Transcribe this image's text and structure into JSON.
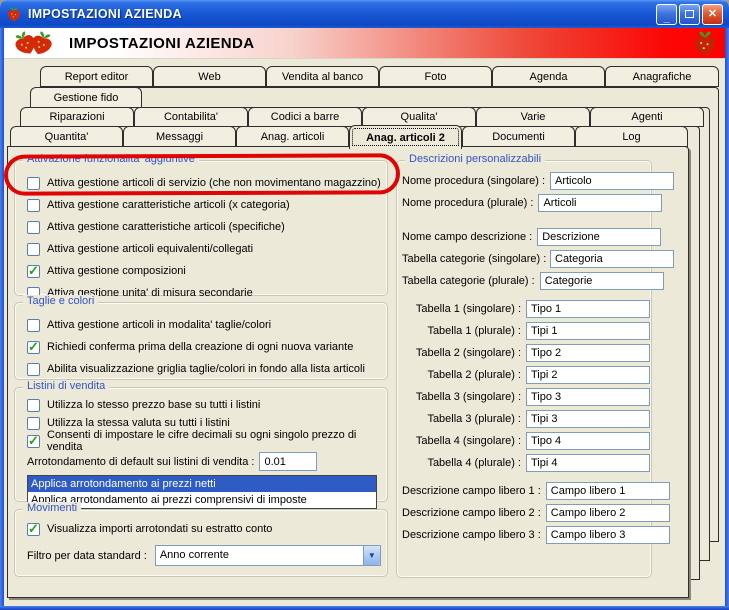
{
  "window": {
    "title": "IMPOSTAZIONI AZIENDA"
  },
  "titlebar_buttons": {
    "minimize": "_",
    "maximize": "",
    "close": "✕"
  },
  "header": {
    "title": "IMPOSTAZIONI AZIENDA"
  },
  "colors": {
    "titlebar_blue": "#1A5AD8",
    "header_red": "#FF0000",
    "group_caption_blue": "#3353C6",
    "selection_blue": "#2F5BC5",
    "check_green": "#1EA11E",
    "annotation_red": "#E00505",
    "window_border_blue": "#1C4FD0",
    "background_beige": "#ECE9D8"
  },
  "tabs": {
    "row1": [
      "Report editor",
      "Web",
      "Vendita al banco",
      "Foto",
      "Agenda",
      "Anagrafiche"
    ],
    "row2": [
      "Gestione fido"
    ],
    "row3": [
      "Riparazioni",
      "Contabilita'",
      "Codici a barre",
      "Qualita'",
      "Varie",
      "Agenti"
    ],
    "row4": [
      "Quantita'",
      "Messaggi",
      "Anag. articoli",
      "Anag. articoli 2",
      "Documenti",
      "Log"
    ],
    "active": "Anag. articoli 2"
  },
  "attivazione": {
    "title": "Attivazione funzionalita' aggiuntive",
    "items": [
      {
        "label": "Attiva gestione articoli di servizio (che non movimentano magazzino)",
        "checked": false
      },
      {
        "label": "Attiva gestione caratteristiche articoli (x categoria)",
        "checked": false
      },
      {
        "label": "Attiva gestione caratteristiche articoli (specifiche)",
        "checked": false
      },
      {
        "label": "Attiva gestione articoli equivalenti/collegati",
        "checked": false
      },
      {
        "label": "Attiva gestione composizioni",
        "checked": true
      },
      {
        "label": "Attiva gestione unita' di misura secondarie",
        "checked": false
      }
    ]
  },
  "taglie": {
    "title": "Taglie e colori",
    "items": [
      {
        "label": "Attiva gestione articoli in modalita' taglie/colori",
        "checked": false
      },
      {
        "label": "Richiedi conferma prima della creazione di ogni nuova variante",
        "checked": true
      },
      {
        "label": "Abilita visualizzazione griglia taglie/colori in fondo alla lista articoli",
        "checked": false
      }
    ]
  },
  "listini": {
    "title": "Listini di vendita",
    "items": [
      {
        "label": "Utilizza lo stesso prezzo base su tutti i listini",
        "checked": false
      },
      {
        "label": "Utilizza la stessa valuta su tutti i listini",
        "checked": false
      },
      {
        "label": "Consenti di impostare le cifre decimali su ogni singolo prezzo di vendita",
        "checked": true
      }
    ],
    "rounding_label": "Arrotondamento di default sui listini di vendita :",
    "rounding_value": "0.01",
    "listbox": [
      "Applica arrotondamento ai prezzi netti",
      "Applica arrotondamento ai prezzi comprensivi di imposte"
    ],
    "listbox_selected_index": 0
  },
  "movimenti": {
    "title": "Movimenti",
    "items": [
      {
        "label": "Visualizza importi arrotondati su estratto conto",
        "checked": true
      }
    ],
    "filter_label": "Filtro per data standard :",
    "filter_value": "Anno corrente"
  },
  "descrizioni": {
    "title": "Descrizioni personalizzabili",
    "fields": [
      {
        "label": "Nome procedura (singolare) :",
        "value": "Articolo"
      },
      {
        "label": "Nome procedura (plurale) :",
        "value": "Articoli"
      },
      {
        "label": "Nome campo descrizione :",
        "value": "Descrizione"
      },
      {
        "label": "Tabella categorie (singolare) :",
        "value": "Categoria"
      },
      {
        "label": "Tabella categorie (plurale) :",
        "value": "Categorie"
      },
      {
        "label": "Tabella 1 (singolare) :",
        "value": "Tipo 1"
      },
      {
        "label": "Tabella 1 (plurale) :",
        "value": "Tipi 1"
      },
      {
        "label": "Tabella 2 (singolare) :",
        "value": "Tipo 2"
      },
      {
        "label": "Tabella 2 (plurale) :",
        "value": "Tipi 2"
      },
      {
        "label": "Tabella 3 (singolare) :",
        "value": "Tipo 3"
      },
      {
        "label": "Tabella 3 (plurale) :",
        "value": "Tipi 3"
      },
      {
        "label": "Tabella 4 (singolare) :",
        "value": "Tipo 4"
      },
      {
        "label": "Tabella 4 (plurale) :",
        "value": "Tipi 4"
      },
      {
        "label": "Descrizione campo libero 1 :",
        "value": "Campo libero 1"
      },
      {
        "label": "Descrizione campo libero 2 :",
        "value": "Campo libero 2"
      },
      {
        "label": "Descrizione campo libero 3 :",
        "value": "Campo libero 3"
      }
    ]
  }
}
